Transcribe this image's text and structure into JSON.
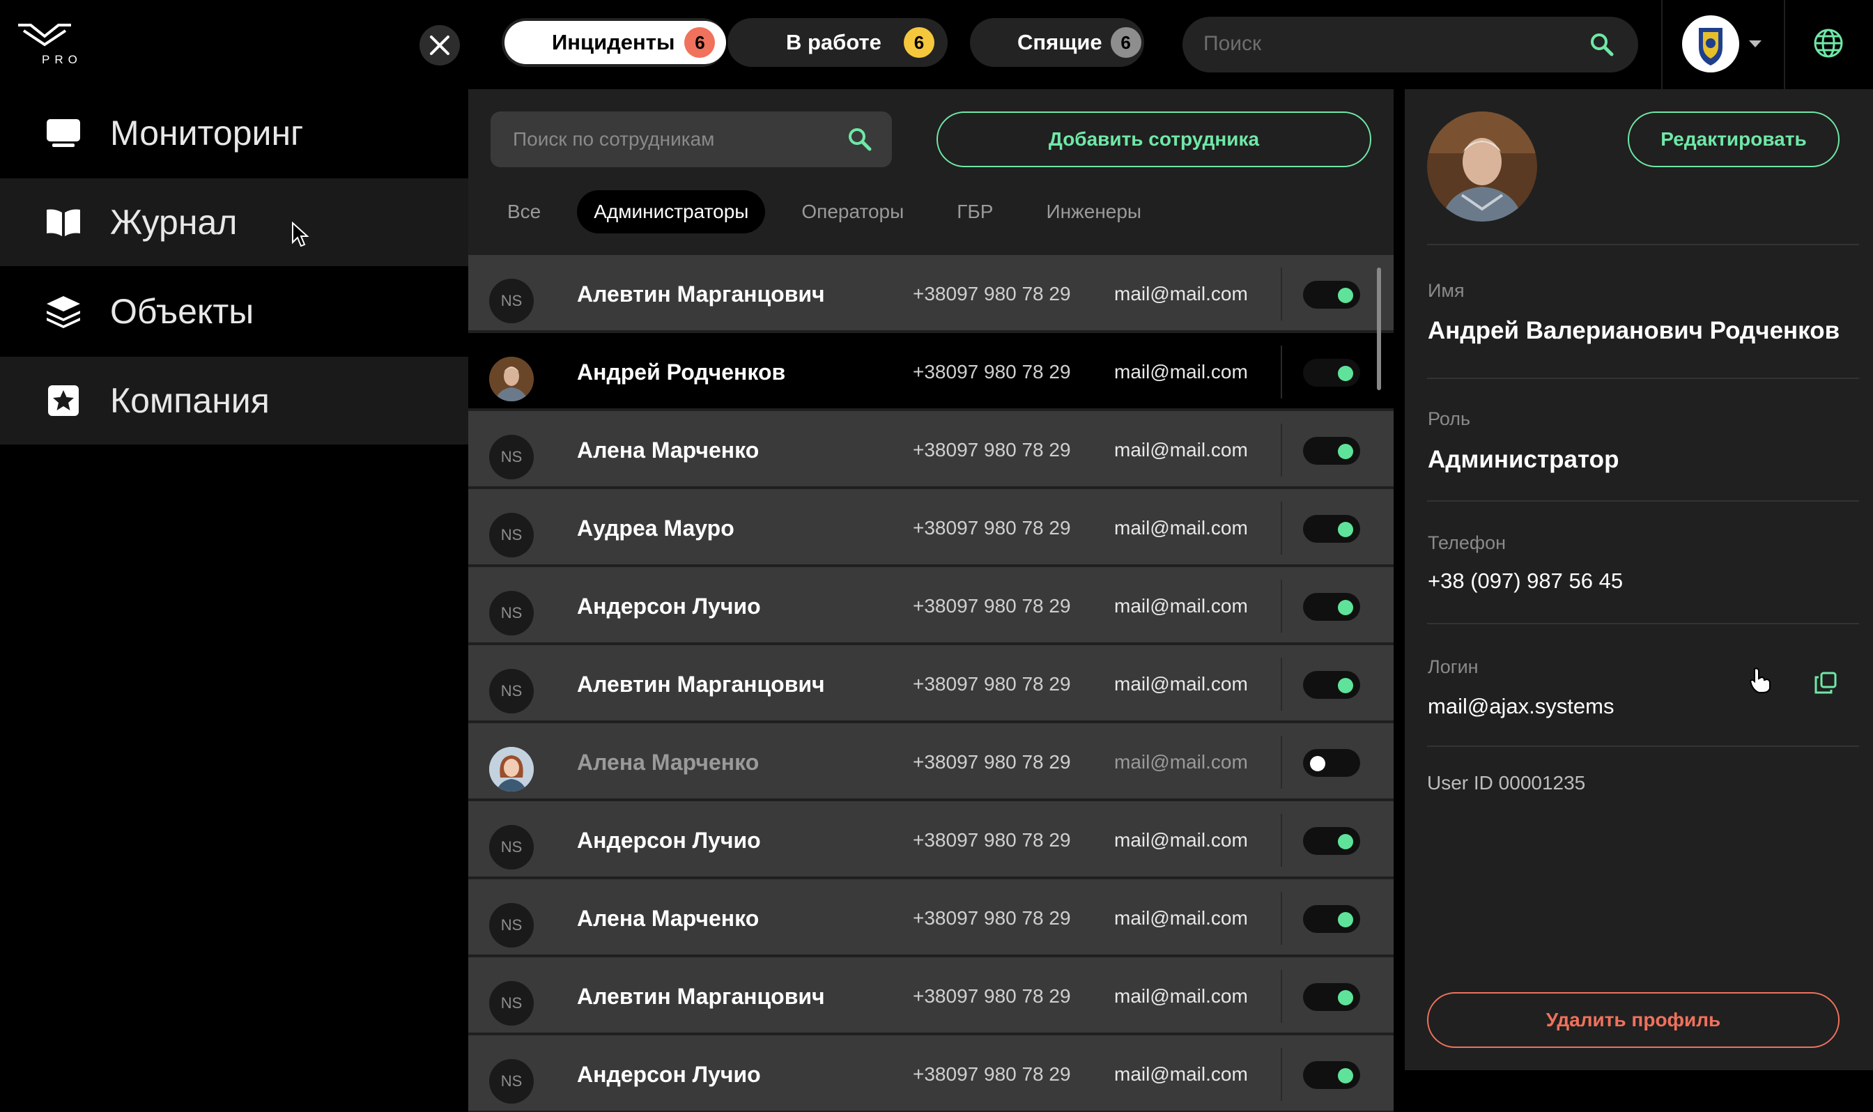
{
  "brand": {
    "logo_text": "PRO"
  },
  "sidebar": {
    "items": [
      {
        "label": "Мониторинг",
        "icon": "monitor-icon"
      },
      {
        "label": "Журнал",
        "icon": "book-icon"
      },
      {
        "label": "Объекты",
        "icon": "layers-icon"
      },
      {
        "label": "Компания",
        "icon": "star-icon"
      }
    ]
  },
  "topbar": {
    "tabs": [
      {
        "label": "Инциденты",
        "count": "6",
        "color": "#f0715c"
      },
      {
        "label": "В работе",
        "count": "6",
        "color": "#f5c73d"
      },
      {
        "label": "Спящие",
        "count": "6",
        "color": "#8e8e8e"
      }
    ],
    "search_placeholder": "Поиск"
  },
  "employees": {
    "search_placeholder": "Поиск по сотрудникам",
    "add_button": "Добавить сотрудника",
    "filters": [
      "Все",
      "Администраторы",
      "Операторы",
      "ГБР",
      "Инженеры"
    ],
    "rows": [
      {
        "initials": "NS",
        "name": "Алевтин Марганцович",
        "phone": "+38097 980 78 29",
        "email": "mail@mail.com",
        "enabled": true
      },
      {
        "initials": "",
        "name": "Андрей Родченков",
        "phone": "+38097 980 78 29",
        "email": "mail@mail.com",
        "enabled": true,
        "selected": true,
        "photo": "man"
      },
      {
        "initials": "NS",
        "name": "Алена Марченко",
        "phone": "+38097 980 78 29",
        "email": "mail@mail.com",
        "enabled": true
      },
      {
        "initials": "NS",
        "name": "Аудреа Мауро",
        "phone": "+38097 980 78 29",
        "email": "mail@mail.com",
        "enabled": true
      },
      {
        "initials": "NS",
        "name": "Андерсон Лучио",
        "phone": "+38097 980 78 29",
        "email": "mail@mail.com",
        "enabled": true
      },
      {
        "initials": "NS",
        "name": "Алевтин Марганцович",
        "phone": "+38097 980 78 29",
        "email": "mail@mail.com",
        "enabled": true
      },
      {
        "initials": "",
        "name": "Алена Марченко",
        "phone": "+38097 980 78 29",
        "email": "mail@mail.com",
        "enabled": false,
        "photo": "woman"
      },
      {
        "initials": "NS",
        "name": "Андерсон Лучио",
        "phone": "+38097 980 78 29",
        "email": "mail@mail.com",
        "enabled": true
      },
      {
        "initials": "NS",
        "name": "Алена Марченко",
        "phone": "+38097 980 78 29",
        "email": "mail@mail.com",
        "enabled": true
      },
      {
        "initials": "NS",
        "name": "Алевтин Марганцович",
        "phone": "+38097 980 78 29",
        "email": "mail@mail.com",
        "enabled": true
      },
      {
        "initials": "NS",
        "name": "Андерсон Лучио",
        "phone": "+38097 980 78 29",
        "email": "mail@mail.com",
        "enabled": true
      }
    ]
  },
  "profile": {
    "edit_button": "Редактировать",
    "name_label": "Имя",
    "name": "Андрей Валерианович Родченков",
    "role_label": "Роль",
    "role": "Администратор",
    "phone_label": "Телефон",
    "phone": "+38 (097) 987 56 45",
    "login_label": "Логин",
    "login": "mail@ajax.systems",
    "user_id": "User ID 00001235",
    "delete_button": "Удалить профиль"
  },
  "colors": {
    "accent": "#6fe8a7",
    "danger": "#f0715c",
    "toggle_on": "#5fe39a"
  }
}
